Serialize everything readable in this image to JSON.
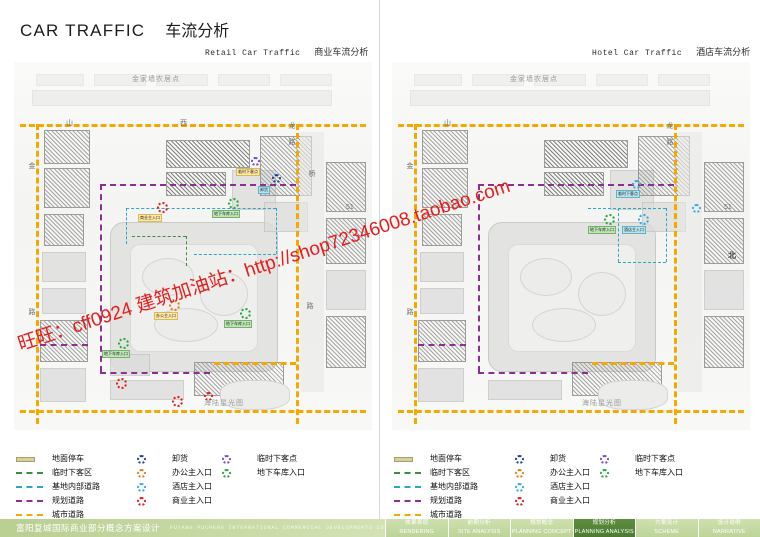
{
  "header": {
    "title_en": "CAR  TRAFFIC",
    "title_cn": "车流分析",
    "left_caption_en": "Retail Car Traffic",
    "left_caption_cn": "商业车流分析",
    "right_caption_en": "Hotel Car Traffic",
    "right_caption_cn": "酒店车流分析"
  },
  "watermark": {
    "text": "旺旺：cff0924  建筑加油站：http://shop72346008.taobao.com",
    "color": "#e41d1d"
  },
  "map": {
    "labels": {
      "top_place": "金家墙农居点",
      "bottom_place": "海陆星光图",
      "compass_north": "北",
      "street_top_1": "山",
      "street_top_2": "西",
      "street_top_3": "龙",
      "street_top_4": "路",
      "street_left_1": "金",
      "street_left_2": "路",
      "street_bridge": "桥",
      "street_right_num": "51",
      "street_bottom": "路"
    },
    "tags": [
      "地下车库入口",
      "商业主入口",
      "办公主入口",
      "酒店主入口",
      "临时下客点",
      "卸货",
      "地面停车"
    ]
  },
  "legend": {
    "columns": [
      {
        "items": [
          {
            "type": "solid",
            "color": "#d8cf9a",
            "label": "地面停车"
          },
          {
            "type": "dash",
            "color": "#3f8f3a",
            "label": "临时下客区"
          },
          {
            "type": "dash",
            "color": "#2aa8c4",
            "label": "基地内部道路"
          },
          {
            "type": "dash",
            "color": "#8c2f91",
            "label": "规划道路"
          },
          {
            "type": "dash",
            "color": "#f5a800",
            "label": "城市道路"
          }
        ]
      },
      {
        "items": [
          {
            "type": "ring",
            "color": "#1a3fa0",
            "label": "卸货"
          },
          {
            "type": "ring",
            "color": "#e8791b",
            "label": "办公主入口"
          },
          {
            "type": "ring",
            "color": "#35a8e0",
            "label": "酒店主入口"
          },
          {
            "type": "ring",
            "color": "#e01b1b",
            "label": "商业主入口"
          }
        ]
      },
      {
        "items": [
          {
            "type": "ring",
            "color": "#7b46c4",
            "label": "临时下客点"
          },
          {
            "type": "ring",
            "color": "#22a83c",
            "label": "地下车库入口"
          }
        ]
      }
    ]
  },
  "footer": {
    "brand_cn": "富阳复城国际商业部分概念方案设计",
    "brand_en": "FUYANG FUCHENG INTERNATIONAL COMMERCIAL DEVELOPMENTS CONCEPT DESIGN",
    "tabs": [
      {
        "cn": "效果表现",
        "en": "RENDERING",
        "active": false
      },
      {
        "cn": "前期分析",
        "en": "SITE ANALYSIS",
        "active": false
      },
      {
        "cn": "规划概念",
        "en": "PLANNING CONCEPT",
        "active": false
      },
      {
        "cn": "规划分析",
        "en": "PLANNING ANALYSIS",
        "active": true
      },
      {
        "cn": "方案设计",
        "en": "SCHEME",
        "active": false
      },
      {
        "cn": "设计说明",
        "en": "NARRATIVE",
        "active": false
      }
    ]
  }
}
